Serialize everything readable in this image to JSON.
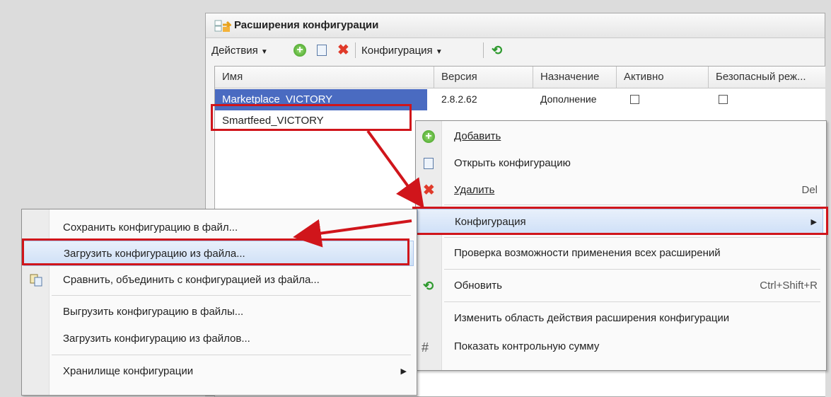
{
  "window": {
    "title": "Расширения конфигурации",
    "toolbar": {
      "actions_label": "Действия",
      "config_label": "Конфигурация"
    },
    "columns": [
      "Имя",
      "Версия",
      "Назначение",
      "Активно",
      "Безопасный реж..."
    ],
    "rows": [
      {
        "name": "Marketplace_VICTORY",
        "version": "2.8.2.62",
        "purpose": "Дополнение"
      },
      {
        "name": "Smartfeed_VICTORY"
      }
    ]
  },
  "context_menu": {
    "items": [
      {
        "label": "Добавить",
        "icon": "plus-green-icon"
      },
      {
        "label": "Открыть конфигурацию",
        "icon": "config-tree-icon"
      },
      {
        "label": "Удалить",
        "icon": "delete-red-x-icon",
        "shortcut": "Del"
      },
      {
        "label": "Конфигурация",
        "submenu": true
      },
      {
        "label": "Проверка возможности применения всех расширений"
      },
      {
        "label": "Обновить",
        "icon": "refresh-green-icon",
        "shortcut": "Ctrl+Shift+R"
      },
      {
        "label": "Изменить область действия расширения конфигурации"
      },
      {
        "label": "Показать контрольную сумму",
        "icon": "checksum-icon"
      }
    ]
  },
  "submenu": {
    "items": [
      {
        "label": "Сохранить конфигурацию в файл..."
      },
      {
        "label": "Загрузить конфигурацию из файла..."
      },
      {
        "label": "Сравнить, объединить с конфигурацией из файла...",
        "icon": "compare-merge-icon"
      },
      {
        "label": "Выгрузить конфигурацию в файлы..."
      },
      {
        "label": "Загрузить конфигурацию из файлов..."
      },
      {
        "label": "Хранилище конфигурации",
        "submenu": true
      }
    ]
  },
  "colors": {
    "selection": "#4a6bc1",
    "highlight_frame": "#d0151b",
    "arrow": "#d0151b"
  }
}
